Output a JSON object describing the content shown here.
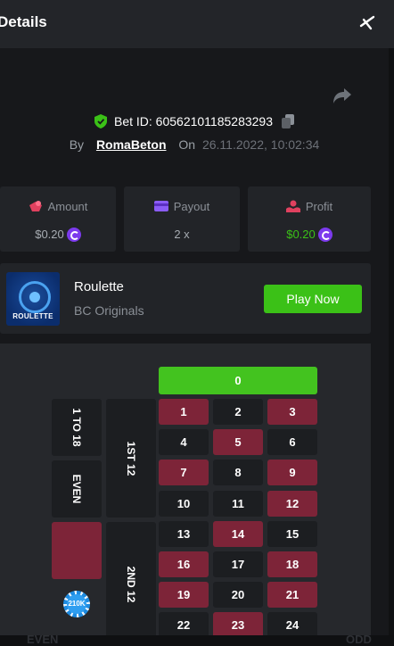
{
  "header": {
    "title": "Details"
  },
  "bet": {
    "id_label": "Bet ID:",
    "id": "60562101185283293",
    "by_label": "By",
    "user": "RomaBeton",
    "on_label": "On",
    "datetime": "26.11.2022, 10:02:34"
  },
  "stats": {
    "amount": {
      "label": "Amount",
      "value": "$0.20"
    },
    "payout": {
      "label": "Payout",
      "value": "2 x"
    },
    "profit": {
      "label": "Profit",
      "value": "$0.20",
      "value_color": "#3bc117"
    }
  },
  "game": {
    "thumb_label": "ROULETTE",
    "name": "Roulette",
    "provider": "BC Originals",
    "play_label": "Play Now"
  },
  "board": {
    "zero": "0",
    "rows": [
      [
        "1",
        "2",
        "3"
      ],
      [
        "4",
        "5",
        "6"
      ],
      [
        "7",
        "8",
        "9"
      ],
      [
        "10",
        "11",
        "12"
      ],
      [
        "13",
        "14",
        "15"
      ],
      [
        "16",
        "17",
        "18"
      ],
      [
        "19",
        "20",
        "21"
      ],
      [
        "22",
        "23",
        "24"
      ]
    ],
    "side_bets": {
      "low": "1 TO 18",
      "even": "EVEN"
    },
    "dozens": {
      "first": "1ST 12",
      "second": "2ND 12"
    },
    "chip_value": "210K",
    "bottom_labels": {
      "even": "EVEN",
      "odd": "ODD"
    }
  },
  "colors": {
    "accent_green": "#3bc117",
    "red": "#7d2438",
    "black": "#1c1e21",
    "coin": "#7c3aed"
  },
  "icons": [
    "close-icon",
    "share-icon",
    "shield-check-icon",
    "copy-icon",
    "amount-icon",
    "payout-icon",
    "profit-icon",
    "coin-icon"
  ]
}
